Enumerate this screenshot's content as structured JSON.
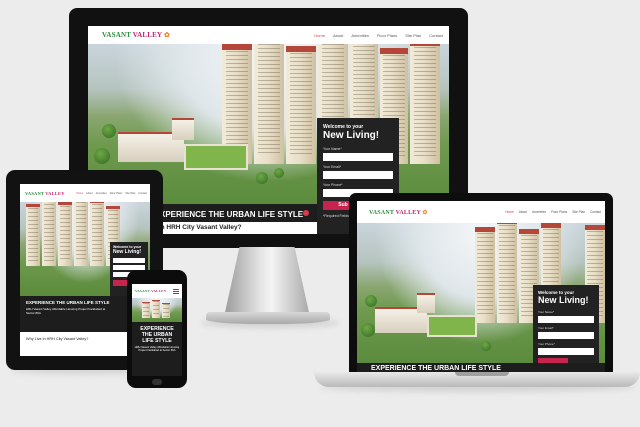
{
  "brand": {
    "name_part1": "VASANT",
    "name_part2": "VALLEY",
    "leaf": "✿"
  },
  "menu": [
    {
      "label": "Home",
      "active": true
    },
    {
      "label": "About"
    },
    {
      "label": "Amenities"
    },
    {
      "label": "Floor Plans"
    },
    {
      "label": "Site Plan"
    },
    {
      "label": "Contact"
    }
  ],
  "monitor": {
    "banner_text": "XPERIENCE THE URBAN LIFE STYLE",
    "question": "ive in HRH City Vasant Valley?",
    "form": {
      "title_line1": "Welcome to your",
      "title_line2": "New Living!",
      "name_label": "Your Name*",
      "email_label": "Your Email*",
      "phone_label": "Your Phone*",
      "submit": "Sub",
      "required_note": "*Required Fields"
    }
  },
  "tablet": {
    "banner_title": "EXPERIENCE THE URBAN LIFE STYLE",
    "banner_sub": "HRH Vasant Valley Affordable Housing Project Faridabad at Sector 86A",
    "question": "Why Live in HRH City Vasant Valley?",
    "form": {
      "title_line1": "Welcome to your",
      "title_line2": "New Living!"
    }
  },
  "phone": {
    "title_line1": "EXPERIENCE",
    "title_line2": "THE URBAN",
    "title_line3": "LIFE STYLE",
    "sub": "HRH Vasant Valley Affordable Housing Project Faridabad at Sector 86A"
  },
  "laptop": {
    "banner_text": "EXPERIENCE THE URBAN LIFE STYLE",
    "form": {
      "title_line1": "Welcome to your",
      "title_line2": "New Living!",
      "name_label": "Your Name*",
      "email_label": "Your Email*",
      "phone_label": "Your Phone*"
    }
  },
  "colors": {
    "accent": "#d83a4a",
    "brand_green": "#2e8b3e",
    "brand_pink": "#c0246a",
    "button": "#c7244d"
  }
}
